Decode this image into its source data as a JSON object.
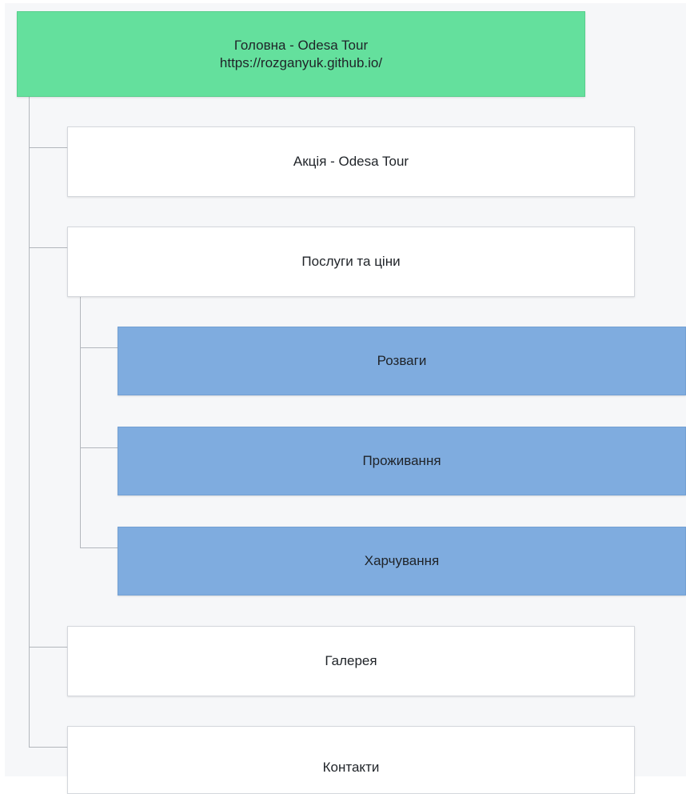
{
  "sitemap": {
    "root": {
      "title": "Головна - Odesa Tour",
      "url": "https://rozganyuk.github.io/",
      "color": "#64e09d"
    },
    "pages": [
      {
        "title": "Акція - Odesa Tour"
      },
      {
        "title": "Послуги та ціни",
        "children": [
          {
            "title": "Розваги"
          },
          {
            "title": "Проживання"
          },
          {
            "title": "Харчування"
          }
        ]
      },
      {
        "title": "Галерея"
      },
      {
        "title": "Контакти"
      }
    ],
    "colors": {
      "page": "#ffffff",
      "subpage": "#7facdf",
      "connector": "#b3b7bd",
      "background": "#f6f7f9"
    }
  }
}
